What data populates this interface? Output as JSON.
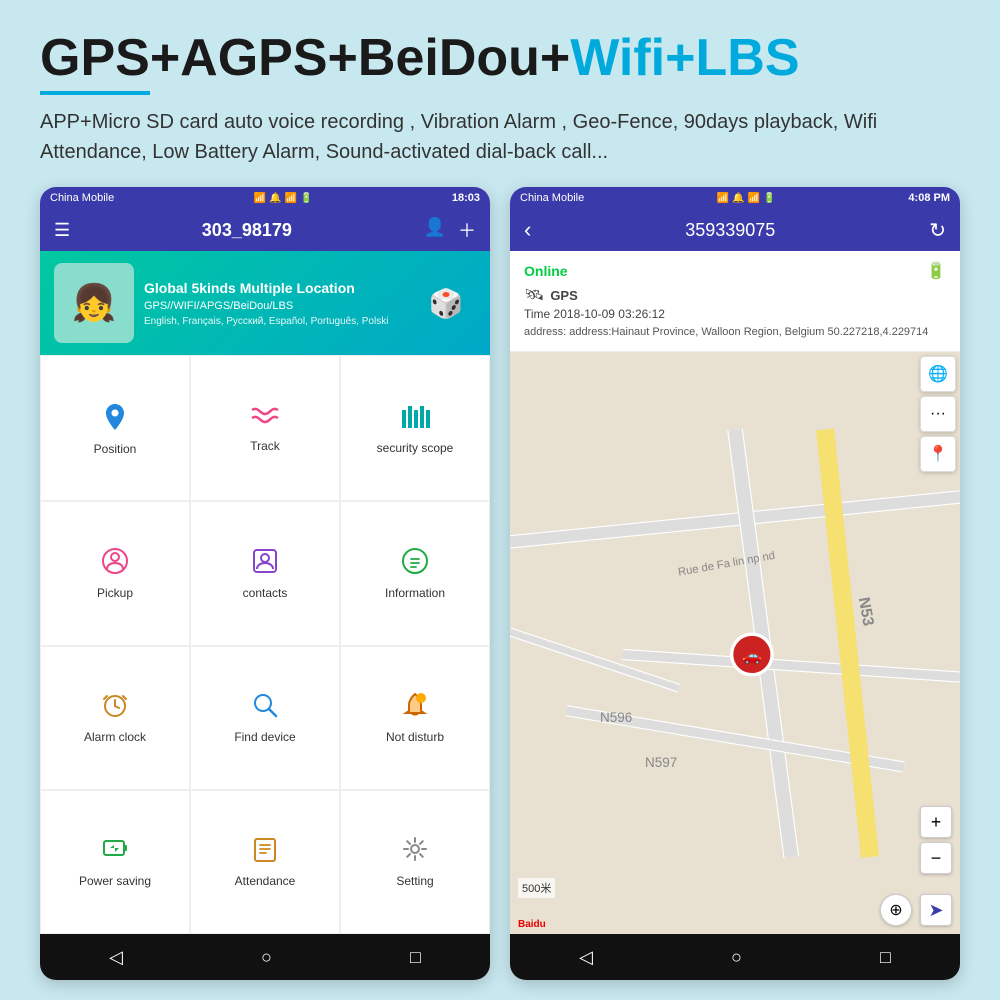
{
  "header": {
    "title_black": "GPS+AGPS+BeiDou+",
    "title_blue": "Wifi+LBS",
    "subtitle": "APP+Micro SD card auto voice recording , Vibration Alarm , Geo-Fence, 90days playback, Wifi Attendance, Low Battery Alarm, Sound-activated dial-back call..."
  },
  "phone_left": {
    "status_bar": {
      "carrier": "China Mobile",
      "time": "18:03",
      "icons": "🔋"
    },
    "app_header": {
      "device_id": "303_98179"
    },
    "banner": {
      "title": "Global 5kinds Multiple Location",
      "subtitle": "GPS//WIFI/APGS/BeiDou/LBS",
      "languages": "English, Français, Русский, Español, Português, Polski"
    },
    "grid": [
      {
        "icon": "📍",
        "label": "Position",
        "color": "blue"
      },
      {
        "icon": "〰",
        "label": "Track",
        "color": "pink"
      },
      {
        "icon": "⛏",
        "label": "security scope",
        "color": "teal"
      },
      {
        "icon": "💬",
        "label": "Pickup",
        "color": "pink"
      },
      {
        "icon": "👤",
        "label": "contacts",
        "color": "purple"
      },
      {
        "icon": "💬",
        "label": "Information",
        "color": "green"
      },
      {
        "icon": "⏰",
        "label": "Alarm clock",
        "color": "orange"
      },
      {
        "icon": "🔍",
        "label": "Find device",
        "color": "blue"
      },
      {
        "icon": "🔔",
        "label": "Not disturb",
        "color": "orange"
      },
      {
        "icon": "🔋",
        "label": "Power saving",
        "color": "green"
      },
      {
        "icon": "📋",
        "label": "Attendance",
        "color": "orange"
      },
      {
        "icon": "⚙",
        "label": "Setting",
        "color": "gray"
      }
    ],
    "nav": [
      "◁",
      "○",
      "□"
    ]
  },
  "phone_right": {
    "status_bar": {
      "carrier": "China Mobile",
      "time": "4:08 PM"
    },
    "map_header": {
      "device_id": "359339075"
    },
    "info": {
      "status": "Online",
      "method": "GPS",
      "time": "Time 2018-10-09 03:26:12",
      "address": "address: address:Hainaut Province, Walloon Region, Belgium 50.227218,4.229714"
    },
    "map": {
      "scale": "500米",
      "logo": "Baidu",
      "roads": [
        "N53",
        "N597",
        "N596",
        "Rue de Fa lin np nd"
      ]
    },
    "nav": [
      "◁",
      "○",
      "□"
    ]
  }
}
